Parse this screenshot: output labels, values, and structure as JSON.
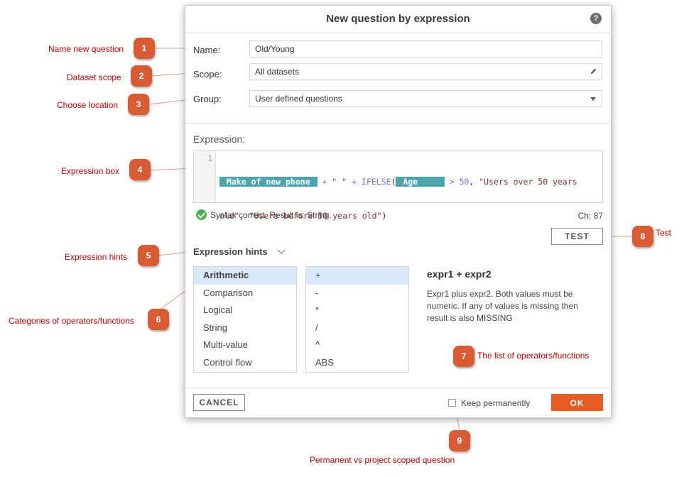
{
  "dialog": {
    "title": "New question by expression",
    "help_glyph": "?",
    "fields": {
      "name_label": "Name:",
      "name_value": "Old/Young",
      "scope_label": "Scope:",
      "scope_value": "All datasets",
      "group_label": "Group:",
      "group_value": "User defined questions"
    },
    "expression": {
      "title": "Expression:",
      "line_number": "1",
      "line1": {
        "chip1": " Make of new phone ",
        "op1": " + ",
        "str1": "\" \"",
        "op2": " + ",
        "fn": "IFELSE",
        "paren": "(",
        "chip2": " Age     ",
        "op3": " > ",
        "num": "50",
        "comma": ", ",
        "str2": "\"Users over 50 years"
      },
      "line2": {
        "str3": "old\"",
        "comma": ", ",
        "str4": "\"Users before 50 years old\"",
        "close": ")"
      }
    },
    "status": {
      "syntax_text": "Syntax correct. Result is: String.",
      "char_count": "Ch: 87"
    },
    "test_button": "TEST",
    "hints": {
      "title": "Expression hints",
      "categories": [
        "Arithmetic",
        "Comparison",
        "Logical",
        "String",
        "Multi-value",
        "Control flow"
      ],
      "selected_category": 0,
      "operators": [
        "+",
        "-",
        "*",
        "/",
        "^",
        "ABS"
      ],
      "selected_operator": 0,
      "desc_title": "expr1 + expr2",
      "desc_text": "Expr1 plus expr2. Both values must be numeric. If any of values is missing then result is also MISSING"
    },
    "footer": {
      "cancel": "CANCEL",
      "keep_label": "Keep permanently",
      "keep_checked": false,
      "ok": "OK"
    }
  },
  "callouts": [
    {
      "num": "1",
      "label": "Name new question"
    },
    {
      "num": "2",
      "label": "Dataset scope"
    },
    {
      "num": "3",
      "label": "Choose location"
    },
    {
      "num": "4",
      "label": "Expression box"
    },
    {
      "num": "5",
      "label": "Expression hints"
    },
    {
      "num": "6",
      "label": "Categories of operators/functions"
    },
    {
      "num": "7",
      "label": "The list of operators/functions"
    },
    {
      "num": "8",
      "label": "Test"
    },
    {
      "num": "9",
      "label": "Permanent vs project scoped question"
    }
  ],
  "colors": {
    "accent": "#e85b25",
    "callout_badge": "#d95b34",
    "callout_text": "#c00000",
    "chip": "#4ca5ad",
    "selection": "#dbeafa",
    "success": "#4caf50"
  }
}
